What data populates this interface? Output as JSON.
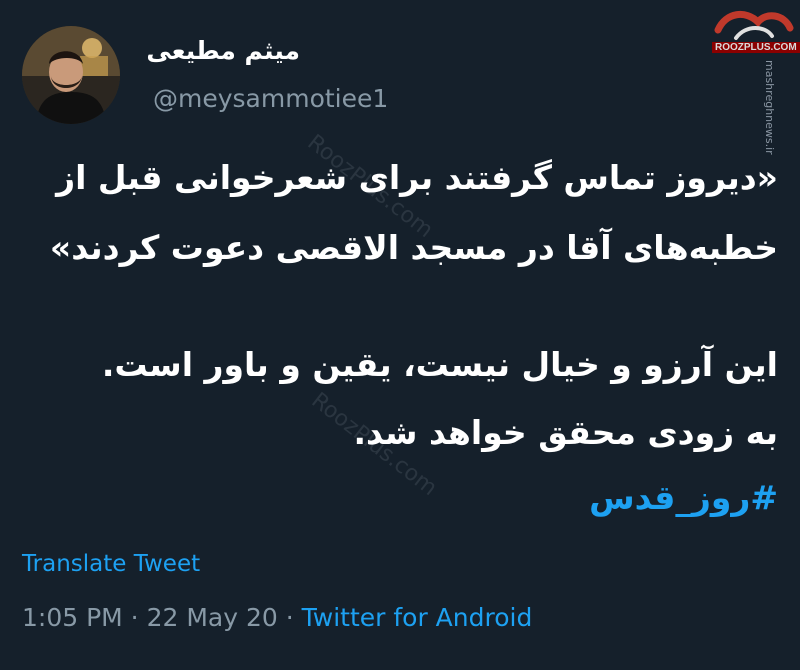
{
  "author": {
    "display_name": "میثم مطیعی",
    "handle": "@meysammotiee1"
  },
  "tweet": {
    "line1": "«دیروز تماس گرفتند برای شعرخوانی قبل از",
    "line2": "خطبه‌های آقا در مسجد الاقصی دعوت کردند»",
    "line3": "این آرزو و خیال نیست، یقین و باور است.",
    "line4": "به زودی محقق خواهد شد.",
    "hashtag": "#روز_قدس"
  },
  "translate_label": "Translate Tweet",
  "meta": {
    "time": "1:05 PM",
    "separator1": " · ",
    "date": "22 May 20",
    "separator2": " · ",
    "source": "Twitter for Android"
  },
  "watermarks": {
    "logo_text": "ROOZPLUS.COM",
    "side_text": "mashreghnews.ir",
    "diag_text": "RoozPlus.com"
  },
  "colors": {
    "background": "#15202b",
    "accent": "#1da1f2",
    "secondary_text": "#8899a6"
  }
}
